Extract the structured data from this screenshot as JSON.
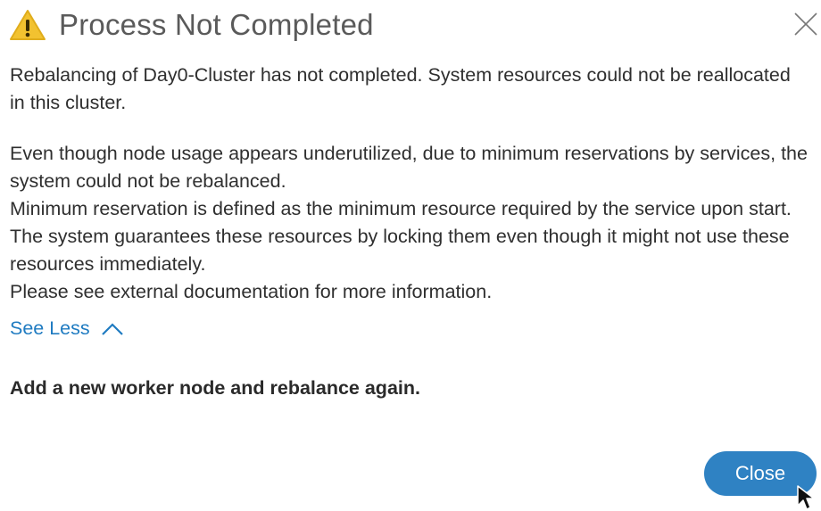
{
  "dialog": {
    "title": "Process Not Completed",
    "icon": "warning-icon",
    "close_icon": "close-icon",
    "paragraph1": "Rebalancing of Day0-Cluster has not completed. System resources could not be reallocated in this cluster.",
    "paragraph2_lines": [
      "Even though node usage appears underutilized, due to minimum reservations by services, the system could not be rebalanced.",
      "Minimum reservation is defined as the minimum resource required by the service upon start. The system guarantees these resources by locking them even though it might not use these resources immediately.",
      "Please see external documentation for more information."
    ],
    "see_less_label": "See Less",
    "action_text": "Add a new worker node and rebalance again.",
    "close_button_label": "Close"
  },
  "colors": {
    "link": "#1f7bc1",
    "button": "#2f82c3",
    "warning": "#f2c230"
  }
}
